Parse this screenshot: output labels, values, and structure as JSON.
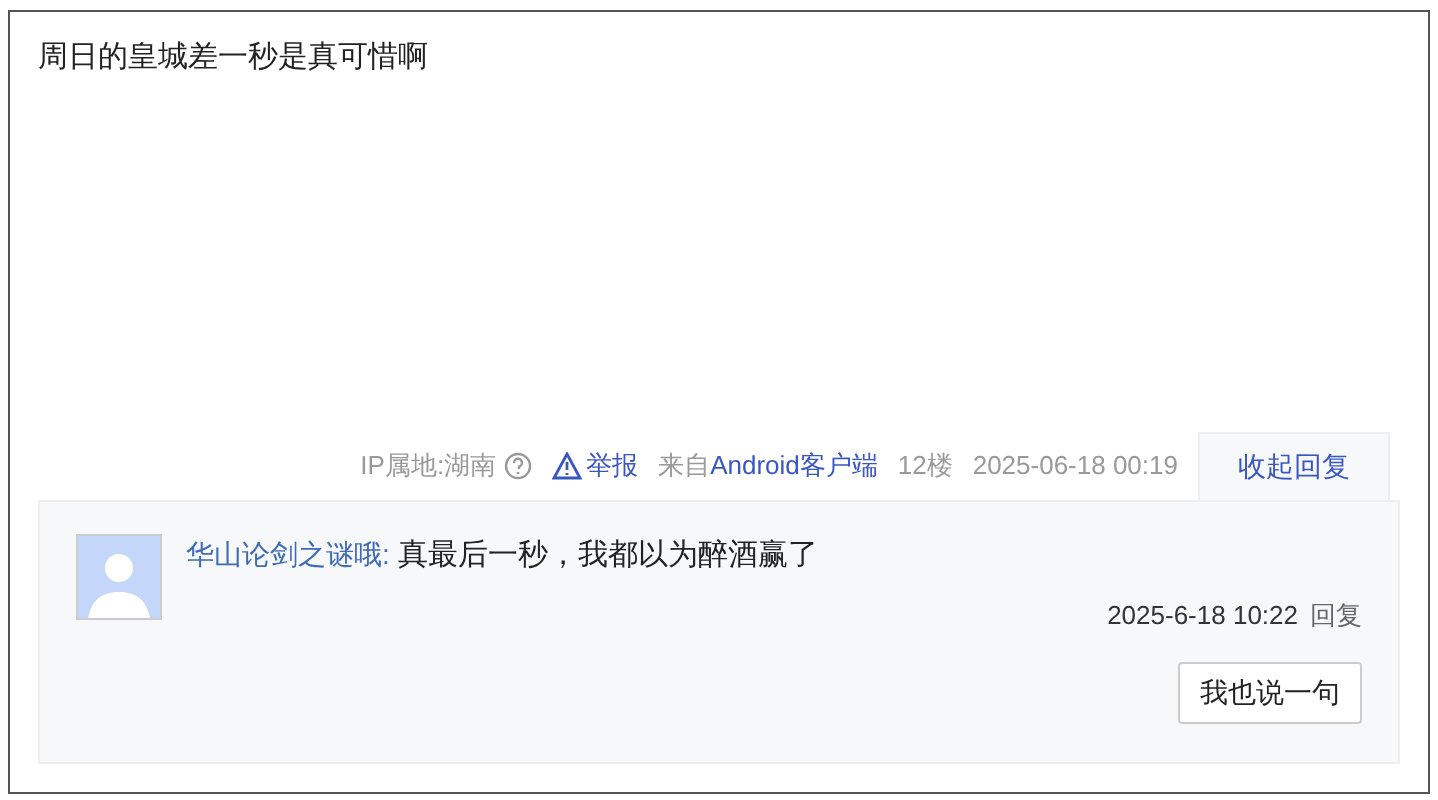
{
  "post": {
    "content": "周日的皇城差一秒是真可惜啊"
  },
  "meta": {
    "ip_location": "IP属地:湖南",
    "report": "举报",
    "source_prefix": "来自",
    "source_link": "Android客户端",
    "floor": "12楼",
    "time": "2025-06-18 00:19",
    "toggle_replies": "收起回复"
  },
  "replies": [
    {
      "author": "华山论剑之谜哦:",
      "text": "真最后一秒，我都以为醉酒赢了",
      "time": "2025-6-18 10:22",
      "reply": "回复"
    }
  ],
  "reply_button": "我也说一句"
}
